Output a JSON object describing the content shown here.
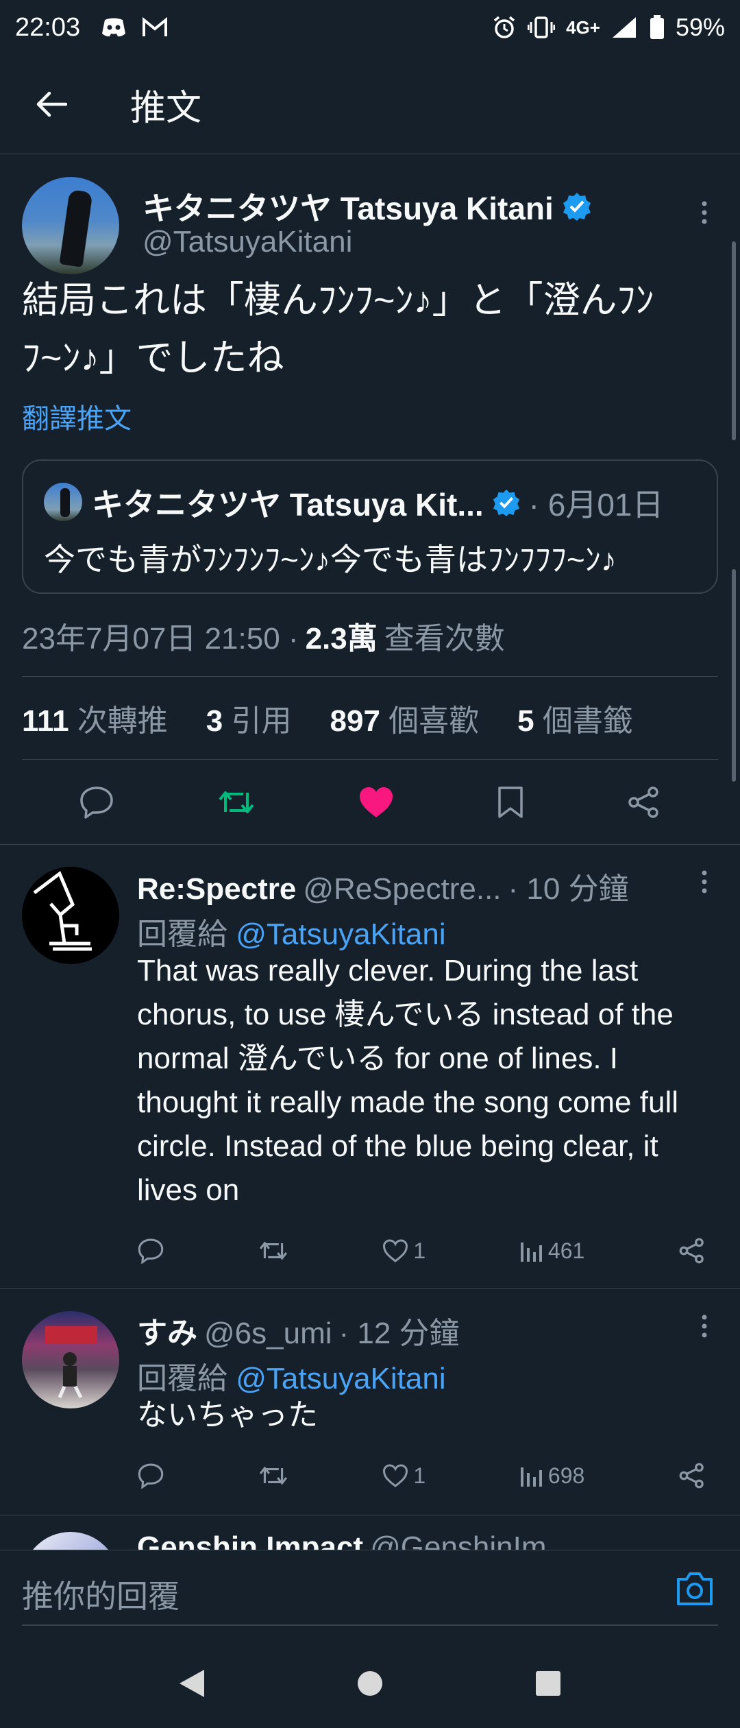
{
  "status_bar": {
    "time": "22:03",
    "network": "4G+",
    "battery": "59%"
  },
  "header": {
    "title": "推文"
  },
  "tweet": {
    "display_name": "キタニタツヤ Tatsuya Kitani",
    "handle": "@TatsuyaKitani",
    "text_line1": "結局これは「棲んﾌﾝﾌ~ﾝ♪」と「澄んﾌﾝ",
    "text_line2": "ﾌ~ﾝ♪」でしたね",
    "translate": "翻譯推文",
    "quote": {
      "name": "キタニタツヤ Tatsuya Kit...",
      "date": "· 6月01日",
      "text": "今でも青がﾌﾝﾌﾝﾌ~ﾝ♪今でも青はﾌﾝﾌﾌﾌ~ﾝ♪"
    },
    "timestamp": "23年7月07日 21:50 ·",
    "views_count": "2.3萬",
    "views_label": "查看次數",
    "retweets_count": "111",
    "retweets_label": "次轉推",
    "quotes_count": "3",
    "quotes_label": "引用",
    "likes_count": "897",
    "likes_label": "個喜歡",
    "bookmarks_count": "5",
    "bookmarks_label": "個書籤"
  },
  "replies": [
    {
      "name": "Re:Spectre",
      "handle": "@ReSpectre...",
      "time": "· 10 分鐘",
      "reply_to_label": "回覆給",
      "reply_to": "@TatsuyaKitani",
      "text": "That was really clever. During the last chorus, to use 棲んでいる instead of the normal 澄んでいる for one of lines. I thought it really made the song come full circle. Instead of the blue being clear, it lives on",
      "likes": "1",
      "views": "461"
    },
    {
      "name": "すみ",
      "handle": "@6s_umi",
      "time": "· 12 分鐘",
      "reply_to_label": "回覆給",
      "reply_to": "@TatsuyaKitani",
      "text": "ないちゃった",
      "likes": "1",
      "views": "698"
    },
    {
      "name": "Genshin Impact",
      "handle": "@GenshinIm"
    }
  ],
  "composer": {
    "placeholder": "推你的回覆"
  },
  "colors": {
    "background": "#15202b",
    "accent": "#1d9bf0",
    "like": "#f91880",
    "retweet": "#00ba7c",
    "link": "#4ba3f5"
  }
}
